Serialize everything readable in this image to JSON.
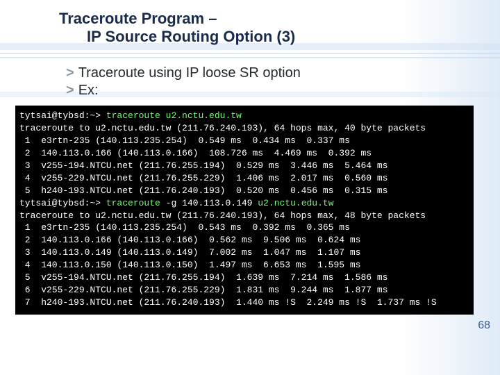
{
  "title": {
    "line1": "Traceroute Program –",
    "line2": "IP Source Routing Option (3)"
  },
  "bullets": {
    "item1": "Traceroute using IP loose SR option",
    "item2": "Ex:"
  },
  "terminal": {
    "l01a": "tytsai@tybsd:~> ",
    "l01b": "traceroute u2.nctu.edu.tw",
    "l02": "traceroute to u2.nctu.edu.tw (211.76.240.193), 64 hops max, 40 byte packets",
    "l03": " 1  e3rtn-235 (140.113.235.254)  0.549 ms  0.434 ms  0.337 ms",
    "l04": " 2  140.113.0.166 (140.113.0.166)  108.726 ms  4.469 ms  0.392 ms",
    "l05": " 3  v255-194.NTCU.net (211.76.255.194)  0.529 ms  3.446 ms  5.464 ms",
    "l06": " 4  v255-229.NTCU.net (211.76.255.229)  1.406 ms  2.017 ms  0.560 ms",
    "l07": " 5  h240-193.NTCU.net (211.76.240.193)  0.520 ms  0.456 ms  0.315 ms",
    "l08a": "tytsai@tybsd:~> ",
    "l08b": "traceroute ",
    "l08c": "-g 140.113.0.149",
    "l08d": " u2.nctu.edu.tw",
    "l09": "traceroute to u2.nctu.edu.tw (211.76.240.193), 64 hops max, 48 byte packets",
    "l10": " 1  e3rtn-235 (140.113.235.254)  0.543 ms  0.392 ms  0.365 ms",
    "l11": " 2  140.113.0.166 (140.113.0.166)  0.562 ms  9.506 ms  0.624 ms",
    "l12": " 3  140.113.0.149 (140.113.0.149)  7.002 ms  1.047 ms  1.107 ms",
    "l13": " 4  140.113.0.150 (140.113.0.150)  1.497 ms  6.653 ms  1.595 ms",
    "l14": " 5  v255-194.NTCU.net (211.76.255.194)  1.639 ms  7.214 ms  1.586 ms",
    "l15": " 6  v255-229.NTCU.net (211.76.255.229)  1.831 ms  9.244 ms  1.877 ms",
    "l16": " 7  h240-193.NTCU.net (211.76.240.193)  1.440 ms !S  2.249 ms !S  1.737 ms !S"
  },
  "page_number": "68"
}
